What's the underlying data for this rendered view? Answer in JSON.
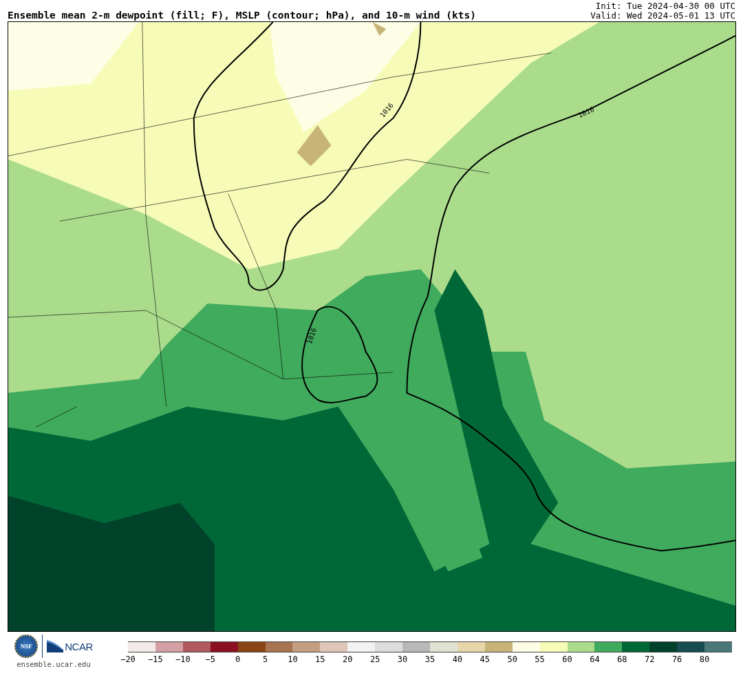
{
  "title": "Ensemble mean 2-m dewpoint (fill; F), MSLP (contour; hPa), and 10-m wind (kts)",
  "init": "Init: Tue 2024-04-30 00 UTC",
  "valid": "Valid: Wed 2024-05-01 13 UTC",
  "map": {
    "contour_labels": [
      "1016",
      "1016",
      "1016"
    ]
  },
  "logos": {
    "nsf": "NSF",
    "ncar": "NCAR",
    "site": "ensemble.ucar.edu"
  },
  "colorbar": [
    {
      "label": "−20",
      "color": "#f5eaea"
    },
    {
      "label": "−15",
      "color": "#d4a0a5"
    },
    {
      "label": "−10",
      "color": "#b05a60"
    },
    {
      "label": "−5",
      "color": "#8a1220"
    },
    {
      "label": "0",
      "color": "#8a4514"
    },
    {
      "label": "5",
      "color": "#a87350"
    },
    {
      "label": "10",
      "color": "#c49e83"
    },
    {
      "label": "15",
      "color": "#e0c6b8"
    },
    {
      "label": "20",
      "color": "#f2f2f2"
    },
    {
      "label": "25",
      "color": "#dcdcdc"
    },
    {
      "label": "30",
      "color": "#b8b8b8"
    },
    {
      "label": "35",
      "color": "#e2e2d2"
    },
    {
      "label": "40",
      "color": "#e6d6aa"
    },
    {
      "label": "45",
      "color": "#c8b478"
    },
    {
      "label": "50",
      "color": "#fefee6"
    },
    {
      "label": "55",
      "color": "#f6fbb8"
    },
    {
      "label": "60",
      "color": "#abdc8c"
    },
    {
      "label": "64",
      "color": "#41ab5d"
    },
    {
      "label": "68",
      "color": "#006837"
    },
    {
      "label": "72",
      "color": "#00422a"
    },
    {
      "label": "76",
      "color": "#174c50"
    },
    {
      "label": "80",
      "color": "#4a7878"
    }
  ]
}
